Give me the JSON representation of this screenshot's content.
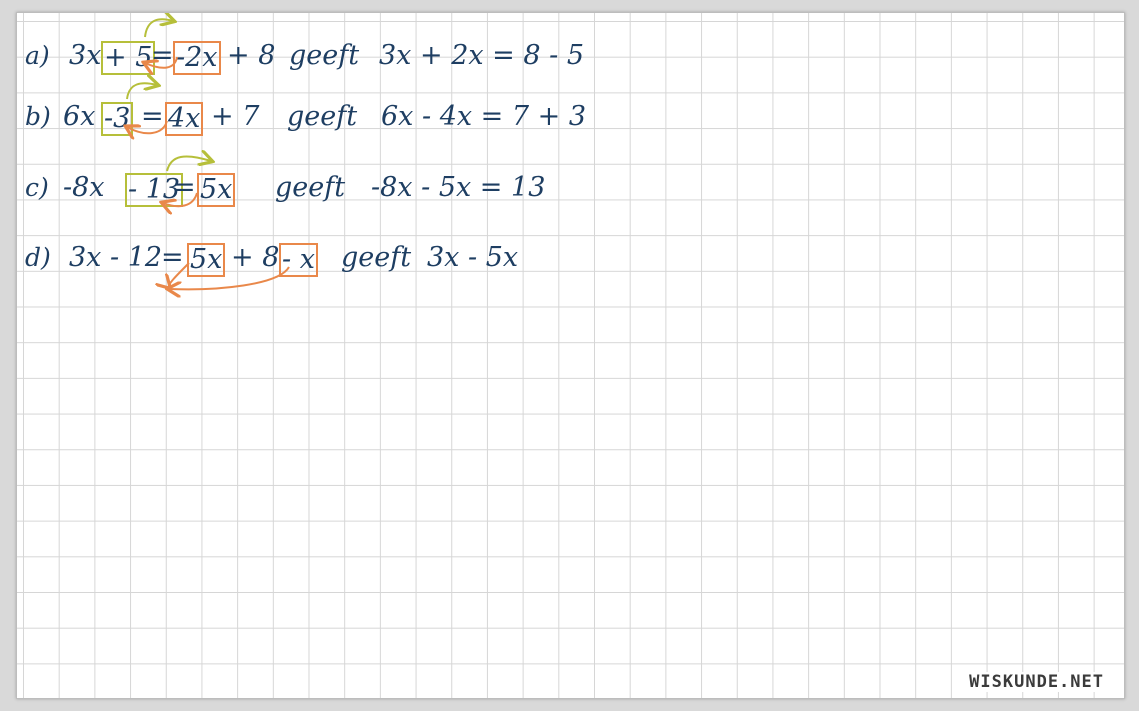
{
  "brand": "WISKUNDE.NET",
  "colors": {
    "ink": "#1e3e62",
    "green_box": "#b6bf3a",
    "orange_box": "#e9884a",
    "grid": "#d6d6d6"
  },
  "rows": [
    {
      "label": "a)",
      "lhs_term": "3x",
      "lhs_boxed": "+ 5",
      "equals": "=",
      "rhs_boxed": "-2x",
      "rhs_rest": "+ 8",
      "word": "geeft",
      "result": "3x + 2x = 8 - 5"
    },
    {
      "label": "b)",
      "lhs_term": "6x",
      "lhs_boxed": "-3",
      "equals": "=",
      "rhs_boxed": "4x",
      "rhs_rest": "+ 7",
      "word": "geeft",
      "result": "6x - 4x = 7 + 3"
    },
    {
      "label": "c)",
      "lhs_term": "-8x",
      "lhs_boxed": "- 13",
      "equals": "=",
      "rhs_boxed": "5x",
      "rhs_rest": "",
      "word": "geeft",
      "result": "-8x - 5x = 13"
    },
    {
      "label": "d)",
      "lhs_term": "3x - 12",
      "equals": "=",
      "rhs_boxed": "5x",
      "rhs_mid": "+ 8",
      "rhs_boxed2": "- x",
      "word": "geeft",
      "result": "3x - 5x"
    }
  ]
}
